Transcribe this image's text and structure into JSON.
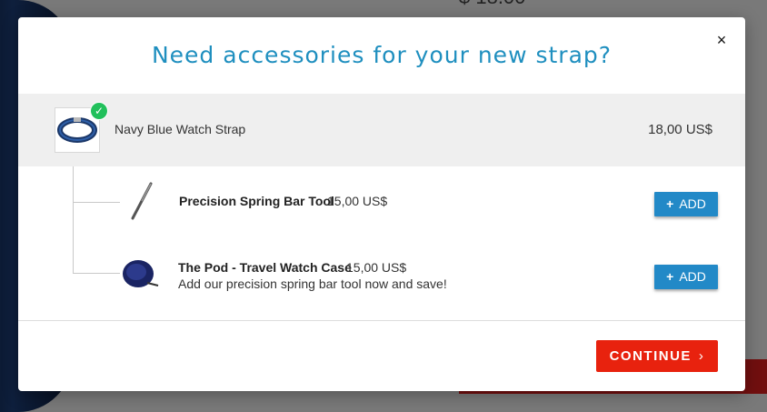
{
  "background": {
    "price_text": "$ 18.00"
  },
  "modal": {
    "title": "Need accessories for your new strap?",
    "close_icon": "×",
    "main_product": {
      "name": "Navy Blue Watch Strap",
      "price": "18,00 US$",
      "check_icon": "✓"
    },
    "accessories": [
      {
        "name": "Precision Spring Bar Tool",
        "price": "15,00 US$",
        "note": "",
        "add_label": "ADD",
        "add_icon": "+",
        "icon": "spring-bar-tool-icon"
      },
      {
        "name": "The Pod - Travel Watch Case",
        "price": "15,00 US$",
        "note": "Add our precision spring bar tool now and save!",
        "add_label": "ADD",
        "add_icon": "+",
        "icon": "travel-watch-case-icon"
      }
    ],
    "continue_label": "CONTINUE",
    "continue_icon": "›"
  },
  "colors": {
    "title": "#1f8fbf",
    "add_button": "#2289c7",
    "continue_button": "#e8220e",
    "check": "#21c05b"
  }
}
